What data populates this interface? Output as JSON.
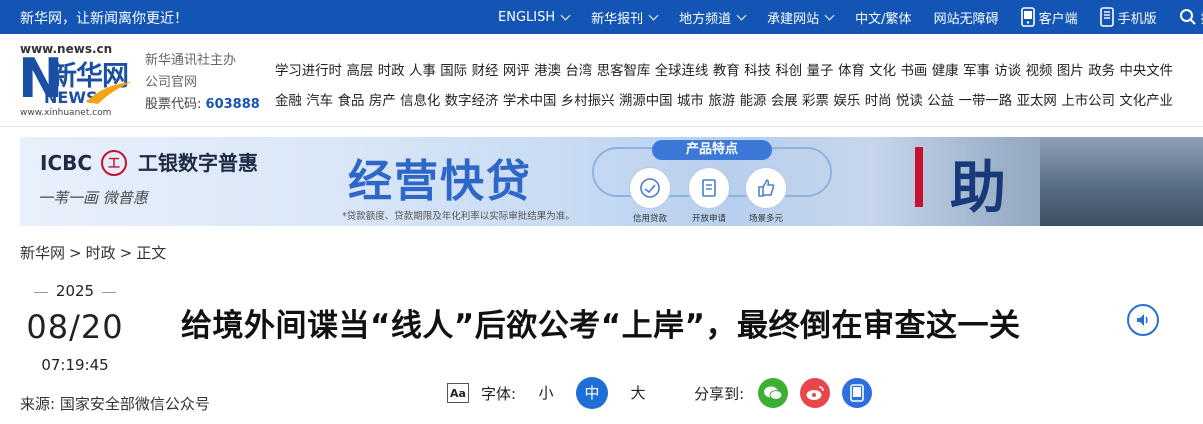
{
  "topbar": {
    "slogan": "新华网，让新闻离你更近！",
    "nav": [
      {
        "label": "ENGLISH",
        "dropdown": true
      },
      {
        "label": "新华报刊",
        "dropdown": true
      },
      {
        "label": "地方频道",
        "dropdown": true
      },
      {
        "label": "承建网站",
        "dropdown": true
      },
      {
        "label": "中文/繁体",
        "dropdown": false
      },
      {
        "label": "网站无障碍",
        "dropdown": false
      },
      {
        "label": "客户端",
        "icon": "phone-icon"
      },
      {
        "label": "手机版",
        "icon": "mobile-icon"
      },
      {
        "label": "搜索",
        "icon": "search-icon"
      }
    ],
    "bg_color": "#1255b5"
  },
  "logo": {
    "url_top": "www.news.cn",
    "name": "新华网",
    "news": "NEWS",
    "url_bottom": "www.xinhuanet.com"
  },
  "company": {
    "line1": "新华通讯社主办",
    "line2": "公司官网",
    "stock_label": "股票代码:",
    "stock_code": "603888"
  },
  "channels": {
    "row1": [
      "学习进行时",
      "高层",
      "时政",
      "人事",
      "国际",
      "财经",
      "网评",
      "港澳",
      "台湾",
      "思客智库",
      "全球连线",
      "教育",
      "科技",
      "科创",
      "量子",
      "体育",
      "文化",
      "书画",
      "健康",
      "军事",
      "访谈",
      "视频",
      "图片",
      "政务",
      "中央文件"
    ],
    "row2": [
      "金融",
      "汽车",
      "食品",
      "房产",
      "信息化",
      "数字经济",
      "学术中国",
      "乡村振兴",
      "溯源中国",
      "城市",
      "旅游",
      "能源",
      "会展",
      "彩票",
      "娱乐",
      "时尚",
      "悦读",
      "公益",
      "一带一路",
      "亚太网",
      "上市公司",
      "文化产业"
    ]
  },
  "banner": {
    "bank": "ICBC",
    "seal": "工",
    "bank_cn": "工银数字普惠",
    "slogan": "一苇一画 微普惠",
    "title": "经营快贷",
    "note": "*贷款额度、贷款期限及年化利率以实际审批结果为准。",
    "features_tag": "产品特点",
    "features": [
      {
        "label": "信用贷款",
        "icon": "credit-icon"
      },
      {
        "label": "开放申请",
        "icon": "apply-icon"
      },
      {
        "label": "场景多元",
        "icon": "thumb-icon"
      }
    ],
    "big_char": "助"
  },
  "breadcrumb": [
    "新华网",
    ">",
    "时政",
    ">",
    "正文"
  ],
  "article": {
    "year": "2025",
    "month_day": "08/20",
    "time": "07:19:45",
    "source_label": "来源:",
    "source": "国家安全部微信公众号",
    "headline": "给境外间谍当“线人”后欲公考“上岸”，最终倒在审查这一关"
  },
  "tools": {
    "font_icon": "Aa",
    "font_label": "字体:",
    "sizes": [
      "小",
      "中",
      "大"
    ],
    "active_size": "中",
    "share_label": "分享到:",
    "share": [
      {
        "name": "wechat-icon",
        "color": "#3cb034"
      },
      {
        "name": "weibo-icon",
        "color": "#e6474a"
      },
      {
        "name": "app-icon",
        "color": "#2d6fe0"
      }
    ]
  }
}
